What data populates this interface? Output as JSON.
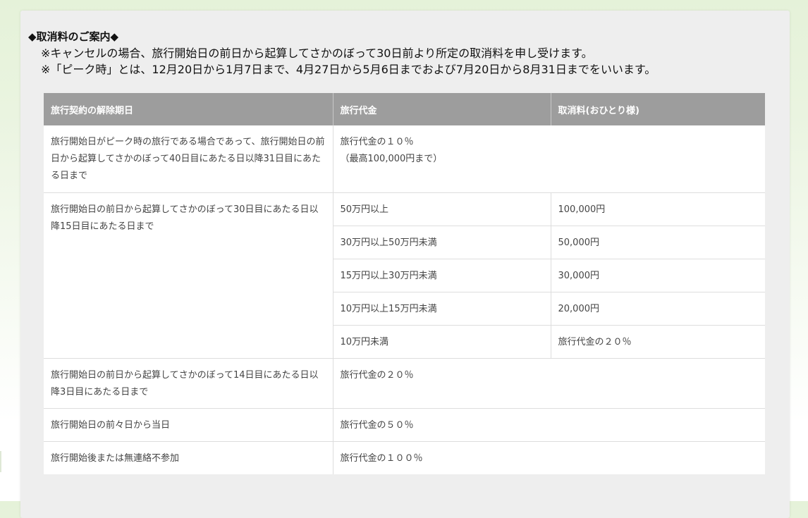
{
  "notice": {
    "heading": "◆取消料のご案内◆",
    "line1": "※キャンセルの場合、旅行開始日の前日から起算してさかのぼって30日前より所定の取消料を申し受けます。",
    "line2": "※「ピーク時」とは、12月20日から1月7日まで、4月27日から5月6日までおよび7月20日から8月31日までをいいます。"
  },
  "table": {
    "headers": [
      "旅行契約の解除期日",
      "旅行代金",
      "取消料(おひとり様)"
    ],
    "row1": {
      "period": "旅行開始日がピーク時の旅行である場合であって、旅行開始日の前日から起算してさかのぼって40日目にあたる日以降31日目にあたる日まで",
      "fee": "旅行代金の１０％\n（最高100,000円まで）"
    },
    "row2": {
      "period": "旅行開始日の前日から起算してさかのぼって30日目にあたる日以降15日目にあたる日まで",
      "tiers": [
        {
          "price": "50万円以上",
          "fee": "100,000円"
        },
        {
          "price": "30万円以上50万円未満",
          "fee": "50,000円"
        },
        {
          "price": "15万円以上30万円未満",
          "fee": "30,000円"
        },
        {
          "price": "10万円以上15万円未満",
          "fee": "20,000円"
        },
        {
          "price": "10万円未満",
          "fee": "旅行代金の２０％"
        }
      ]
    },
    "row3": {
      "period": "旅行開始日の前日から起算してさかのぼって14日目にあたる日以降3日目にあたる日まで",
      "fee": "旅行代金の２０％"
    },
    "row4": {
      "period": "旅行開始日の前々日から当日",
      "fee": "旅行代金の５０％"
    },
    "row5": {
      "period": "旅行開始後または無連絡不参加",
      "fee": "旅行代金の１００％"
    }
  }
}
